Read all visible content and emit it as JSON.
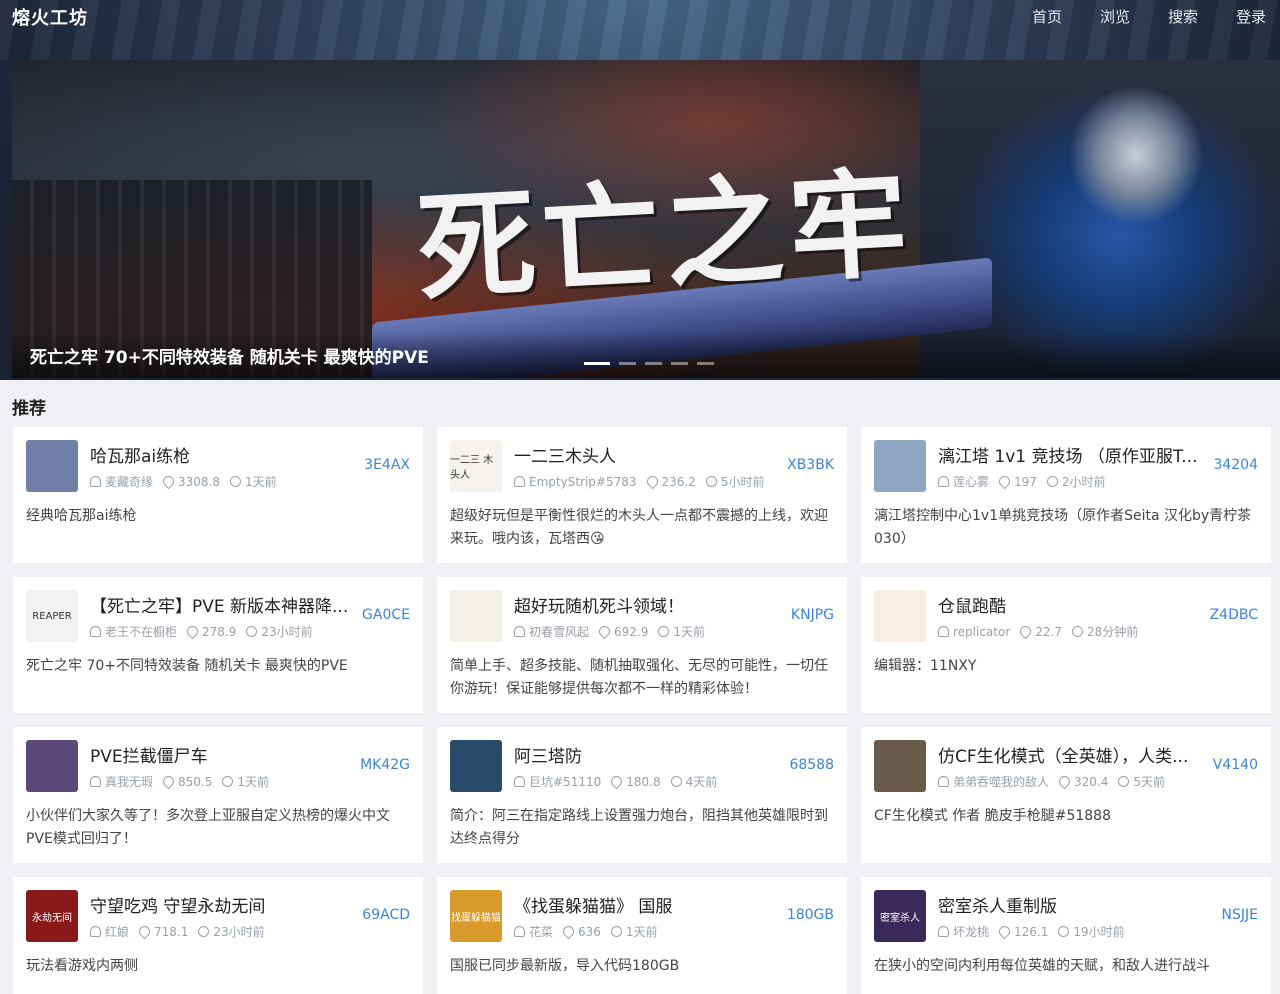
{
  "header": {
    "logo": "熔火工坊",
    "nav": [
      "首页",
      "浏览",
      "搜索",
      "登录"
    ]
  },
  "banner": {
    "title_art": "死亡之牢",
    "caption": "死亡之牢 70+不同特效装备 随机关卡 最爽快的PVE",
    "slides": 5,
    "active_slide": 1
  },
  "section": {
    "title": "推荐"
  },
  "cards": [
    {
      "title": "哈瓦那ai练枪",
      "code": "3E4AX",
      "author": "麦藏奇缘",
      "heat": "3308.8",
      "time": "1天前",
      "desc": "经典哈瓦那ai练枪",
      "thumb_color": "#6f7fa8",
      "thumb_text": ""
    },
    {
      "title": "一二三木头人",
      "code": "XB3BK",
      "author": "EmptyStrip#5783",
      "heat": "236.2",
      "time": "5小时前",
      "desc": "超级好玩但是平衡性很烂的木头人一点都不震撼的上线，欢迎来玩。哦内该，瓦塔西😘",
      "thumb_color": "#f6f3ee",
      "thumb_text": "一二三 木头人"
    },
    {
      "title": "漓江塔 1v1 竞技场 （原作亚服T...",
      "code": "34204",
      "author": "莲心雾",
      "heat": "197",
      "time": "2小时前",
      "desc": "漓江塔控制中心1v1单挑竞技场（原作者Seita 汉化by青柠茶030）",
      "thumb_color": "#8fa7c2",
      "thumb_text": ""
    },
    {
      "title": "【死亡之牢】PVE 新版本神器降...",
      "code": "GA0CE",
      "author": "老王不在橱柜",
      "heat": "278.9",
      "time": "23小时前",
      "desc": "死亡之牢 70+不同特效装备 随机关卡 最爽快的PVE",
      "thumb_color": "#f2f2f2",
      "thumb_text": "REAPER"
    },
    {
      "title": "超好玩随机死斗领域！",
      "code": "KNJPG",
      "author": "初春雪风起",
      "heat": "692.9",
      "time": "1天前",
      "desc": "简单上手、超多技能、随机抽取强化、无尽的可能性，一切任你游玩！保证能够提供每次都不一样的精彩体验！",
      "thumb_color": "#f4f1e8",
      "thumb_text": ""
    },
    {
      "title": "仓鼠跑酷",
      "code": "Z4DBC",
      "author": "replicator",
      "heat": "22.7",
      "time": "28分钟前",
      "desc": "编辑器：11NXY",
      "thumb_color": "#f6efe2",
      "thumb_text": ""
    },
    {
      "title": "PVE拦截僵尸车",
      "code": "MK42G",
      "author": "真我无瑕",
      "heat": "850.5",
      "time": "1天前",
      "desc": "小伙伴们大家久等了！多次登上亚服自定义热榜的爆火中文PVE模式回归了！",
      "thumb_color": "#5a4a7a",
      "thumb_text": ""
    },
    {
      "title": "阿三塔防",
      "code": "68588",
      "author": "巨坑#51110",
      "heat": "180.8",
      "time": "4天前",
      "desc": "简介：阿三在指定路线上设置强力炮台，阻挡其他英雄限时到达终点得分",
      "thumb_color": "#2a4a6a",
      "thumb_text": ""
    },
    {
      "title": "仿CF生化模式（全英雄），人类...",
      "code": "V4140",
      "author": "弟弟吞噬我的敌人",
      "heat": "320.4",
      "time": "5天前",
      "desc": "CF生化模式 作者 脆皮手枪腿#51888",
      "thumb_color": "#6a5a4a",
      "thumb_text": ""
    },
    {
      "title": "守望吃鸡 守望永劫无间",
      "code": "69ACD",
      "author": "红娘",
      "heat": "718.1",
      "time": "23小时前",
      "desc": "玩法看游戏内两侧",
      "thumb_color": "#8a1a1a",
      "thumb_text": "永劫无间"
    },
    {
      "title": "《找蛋躲猫猫》 国服",
      "code": "180GB",
      "author": "花菜",
      "heat": "636",
      "time": "1天前",
      "desc": "国服已同步最新版，导入代码180GB",
      "thumb_color": "#d89a2a",
      "thumb_text": "找蛋躲猫猫"
    },
    {
      "title": "密室杀人重制版",
      "code": "NSJJE",
      "author": "坏龙桃",
      "heat": "126.1",
      "time": "19小时前",
      "desc": "在狭小的空间内利用每位英雄的天赋，和敌人进行战斗",
      "thumb_color": "#3a2a5a",
      "thumb_text": "密室杀人"
    }
  ]
}
